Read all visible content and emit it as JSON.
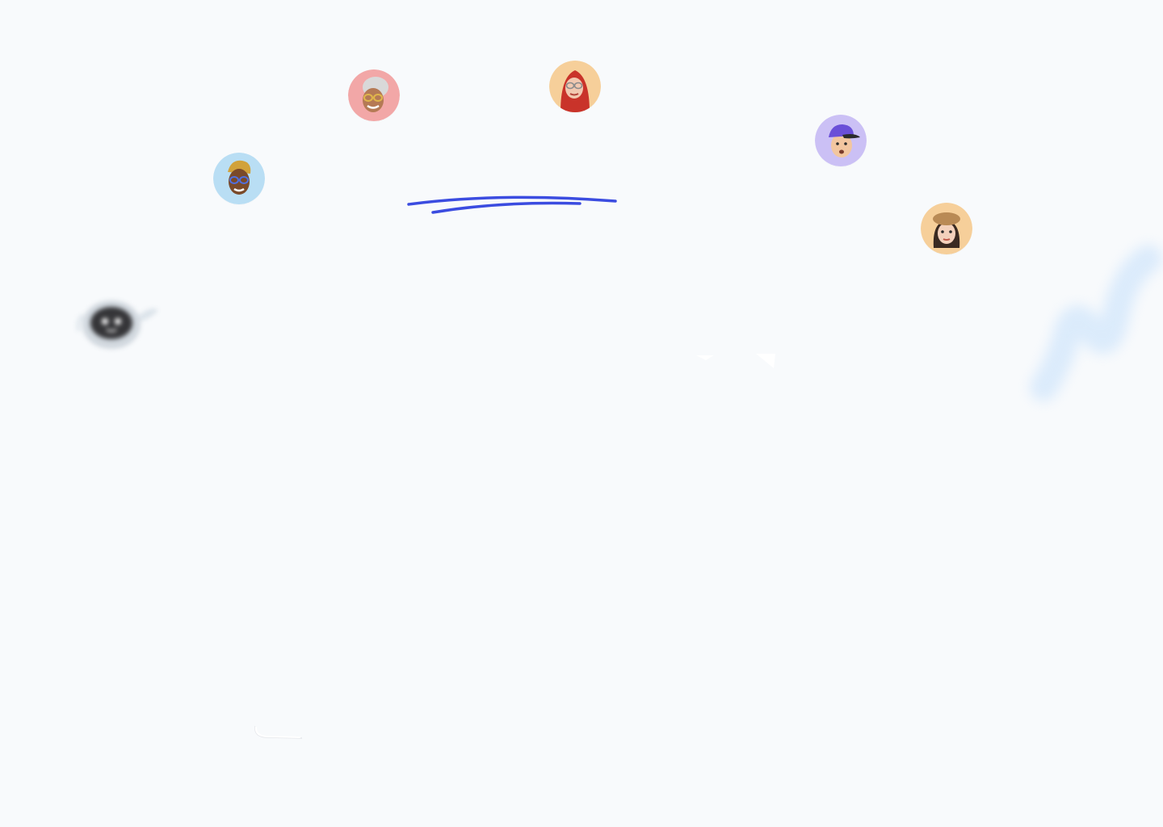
{
  "page": {
    "background_color": "#f8fafc",
    "accent_color": "#3b4ce0"
  },
  "decorations": {
    "avatars": [
      {
        "name": "avatar-older-woman",
        "icon": "memoji-older-woman-icon",
        "bg": "#f2a7a7"
      },
      {
        "name": "avatar-hijab-woman",
        "icon": "memoji-hijab-woman-icon",
        "bg": "#f6cf9a"
      },
      {
        "name": "avatar-man-glasses",
        "icon": "memoji-man-glasses-icon",
        "bg": "#b9def4"
      },
      {
        "name": "avatar-man-cap",
        "icon": "memoji-man-cap-icon",
        "bg": "#cbc0f5"
      },
      {
        "name": "avatar-woman-beret",
        "icon": "memoji-woman-beret-icon",
        "bg": "#f6cf9a"
      }
    ],
    "robot": {
      "icon": "robot-mascot-icon"
    },
    "squiggle": {
      "icon": "blue-squiggle-icon",
      "color": "#cfe5fb"
    }
  }
}
